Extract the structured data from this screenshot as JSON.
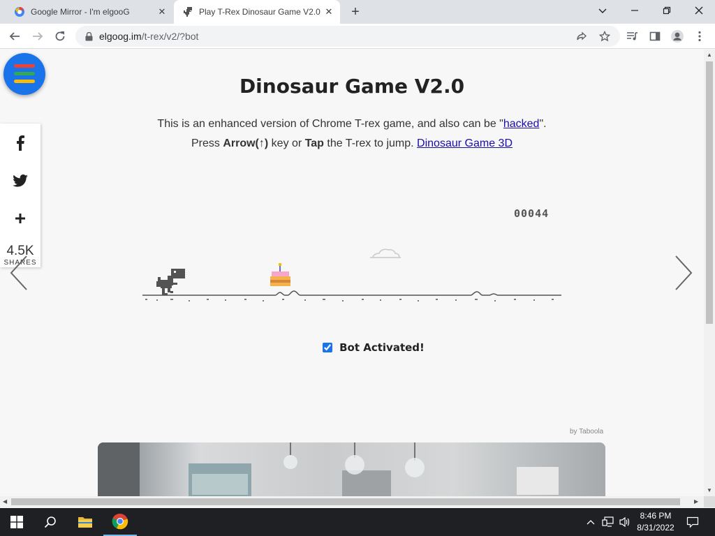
{
  "tabs": [
    {
      "title": "Google Mirror - I'm elgooG",
      "favicon": "elgoog-icon",
      "active": false
    },
    {
      "title": "Play T-Rex Dinosaur Game V2.0 (",
      "favicon": "dino-icon",
      "active": true
    }
  ],
  "address_bar": {
    "domain": "elgoog.im",
    "path": "/t-rex/v2/?bot"
  },
  "page": {
    "title": "Dinosaur Game V2.0",
    "intro_text": "This is an enhanced version of Chrome T-rex game, and also can be \"",
    "hacked_link": "hacked",
    "intro_tail": "\".",
    "press_text": "Press ",
    "arrow_key": "Arrow(↑)",
    "key_or": " key or ",
    "tap_word": "Tap",
    "jump_text": " the T-rex to jump. ",
    "game3d_link": "Dinosaur Game 3D",
    "bot_label": "Bot Activated!",
    "bot_checked": true,
    "taboola_label": "by Taboola"
  },
  "game": {
    "score": "00044"
  },
  "share": {
    "count": "4.5K",
    "label": "SHARES"
  },
  "menu_colors": [
    "#ea4335",
    "#34a853",
    "#fbbc05"
  ],
  "taskbar": {
    "time": "8:46 PM",
    "date": "8/31/2022"
  }
}
